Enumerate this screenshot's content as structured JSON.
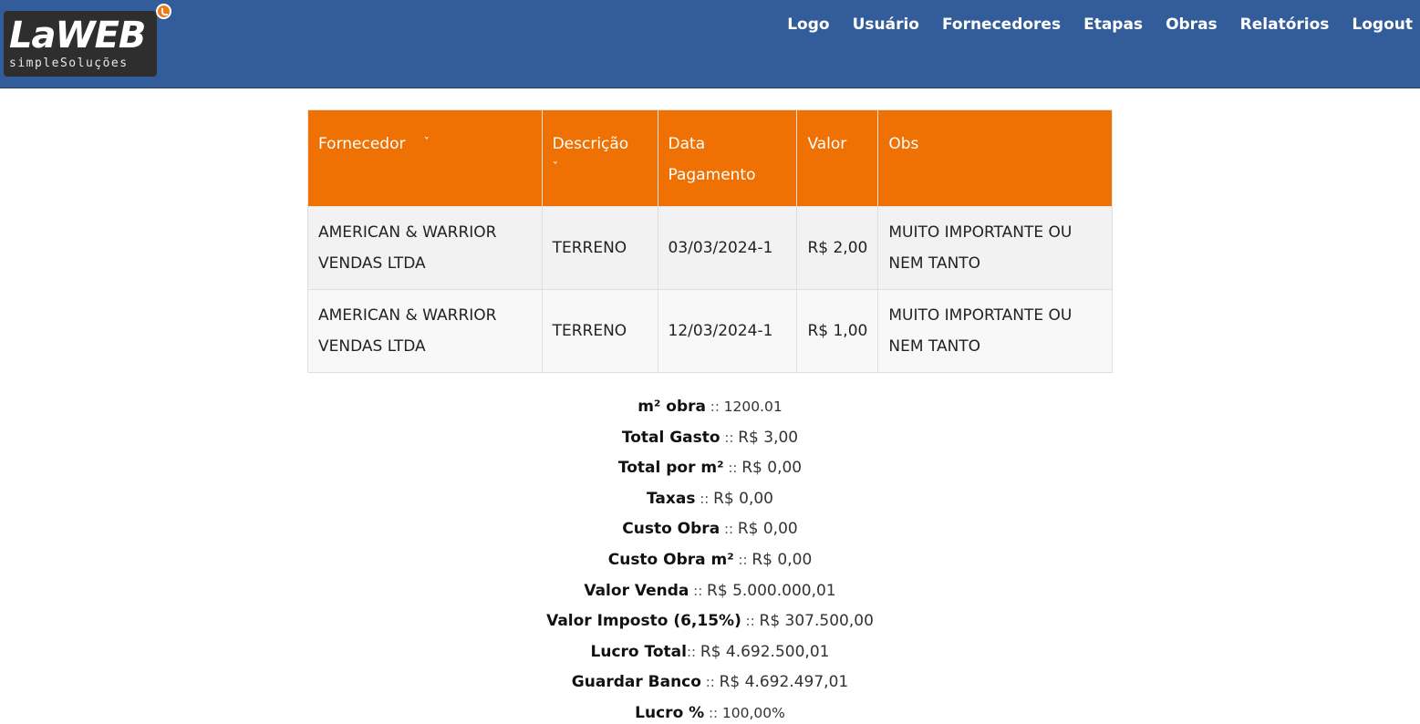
{
  "header": {
    "logo": {
      "mark": "LaWEB",
      "subtitle": "simpleSoluções"
    },
    "nav": [
      "Logo",
      "Usuário",
      "Fornecedores",
      "Etapas",
      "Obras",
      "Relatórios",
      "Logout"
    ]
  },
  "table": {
    "headers": {
      "fornecedor": "Fornecedor",
      "descricao": "Descrição",
      "data_pagamento_1": "Data",
      "data_pagamento_2": "Pagamento",
      "valor": "Valor",
      "obs": "Obs"
    },
    "sort_icon": "sort-icon",
    "rows": [
      {
        "fornecedor_1": "AMERICAN & WARRIOR",
        "fornecedor_2": "VENDAS LTDA",
        "descricao": "TERRENO",
        "data": "03/03/2024-1",
        "valor": "R$ 2,00",
        "obs_1": "MUITO IMPORTANTE OU",
        "obs_2": "NEM TANTO"
      },
      {
        "fornecedor_1": "AMERICAN & WARRIOR",
        "fornecedor_2": "VENDAS LTDA",
        "descricao": "TERRENO",
        "data": "12/03/2024-1",
        "valor": "R$ 1,00",
        "obs_1": "MUITO IMPORTANTE OU",
        "obs_2": "NEM TANTO"
      }
    ]
  },
  "summary": [
    {
      "label": "m² obra",
      "sep": " :: ",
      "value": "1200.01"
    },
    {
      "label": "Total Gasto",
      "sep": " :: ",
      "value": "R$ 3,00"
    },
    {
      "label": "Total por m²",
      "sep": " :: ",
      "value": "R$ 0,00"
    },
    {
      "label": "Taxas",
      "sep": " :: ",
      "value": "R$ 0,00"
    },
    {
      "label": "Custo Obra",
      "sep": " :: ",
      "value": "R$ 0,00"
    },
    {
      "label": "Custo Obra m²",
      "sep": " :: ",
      "value": "R$ 0,00"
    },
    {
      "label": "Valor Venda",
      "sep": " :: ",
      "value": "R$ 5.000.000,01"
    },
    {
      "label": "Valor Imposto (6,15%)",
      "sep": " :: ",
      "value": "R$ 307.500,00"
    },
    {
      "label": "Lucro Total",
      "sep": ":: ",
      "value": "R$ 4.692.500,01"
    },
    {
      "label": "Guardar Banco",
      "sep": " :: ",
      "value": "R$ 4.692.497,01"
    },
    {
      "label": "Lucro %",
      "sep": " :: ",
      "value": "100,00%"
    }
  ],
  "colors": {
    "header_bg": "#325c9a",
    "table_header_bg": "#ef7103",
    "row_odd_bg": "#f2f2f2",
    "row_even_bg": "#f8f8f8"
  }
}
